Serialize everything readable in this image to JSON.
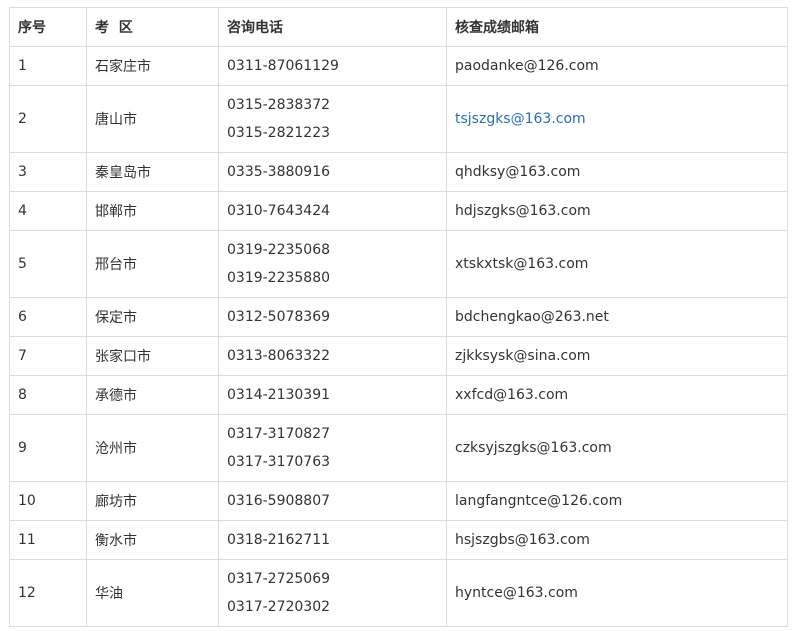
{
  "table": {
    "headers": [
      "序号",
      "考  区",
      "咨询电话",
      "核查成绩邮箱"
    ],
    "rows": [
      {
        "no": "1",
        "region": "石家庄市",
        "phones": [
          "0311-87061129"
        ],
        "email": "paodanke@126.com"
      },
      {
        "no": "2",
        "region": "唐山市",
        "phones": [
          "0315-2838372",
          "0315-2821223"
        ],
        "email": "tsjszgks@163.com",
        "email_link": true
      },
      {
        "no": "3",
        "region": "秦皇岛市",
        "phones": [
          "0335-3880916"
        ],
        "email": "qhdksy@163.com"
      },
      {
        "no": "4",
        "region": "邯郸市",
        "phones": [
          "0310-7643424"
        ],
        "email": "hdjszgks@163.com"
      },
      {
        "no": "5",
        "region": "邢台市",
        "phones": [
          "0319-2235068",
          "0319-2235880"
        ],
        "email": "xtskxtsk@163.com"
      },
      {
        "no": "6",
        "region": "保定市",
        "phones": [
          "0312-5078369"
        ],
        "email": "bdchengkao@263.net"
      },
      {
        "no": "7",
        "region": "张家口市",
        "phones": [
          "0313-8063322"
        ],
        "email": "zjkksysk@sina.com"
      },
      {
        "no": "8",
        "region": "承德市",
        "phones": [
          "0314-2130391"
        ],
        "email": "xxfcd@163.com"
      },
      {
        "no": "9",
        "region": "沧州市",
        "phones": [
          "0317-3170827",
          "0317-3170763"
        ],
        "email": "czksyjszgks@163.com"
      },
      {
        "no": "10",
        "region": "廊坊市",
        "phones": [
          "0316-5908807"
        ],
        "email": "langfangntce@126.com"
      },
      {
        "no": "11",
        "region": "衡水市",
        "phones": [
          "0318-2162711"
        ],
        "email": "hsjszgbs@163.com"
      },
      {
        "no": "12",
        "region": "华油",
        "phones": [
          "0317-2725069",
          "0317-2720302"
        ],
        "email": "hyntce@163.com"
      }
    ],
    "link_color": "#2a6fb0"
  }
}
